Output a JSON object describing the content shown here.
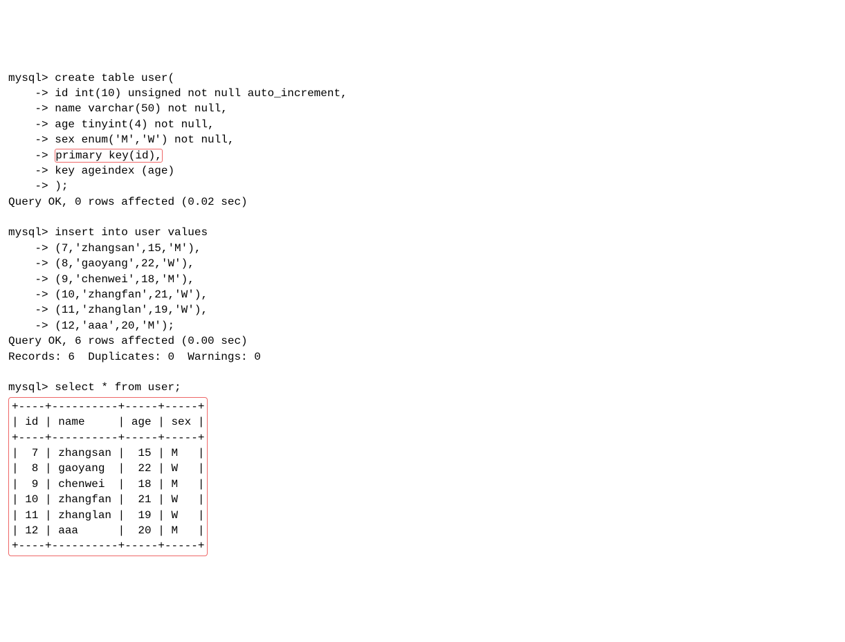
{
  "terminal": {
    "prompt": "mysql> ",
    "cont": "    -> ",
    "create_table": {
      "l0": "create table user(",
      "l1": "id int(10) unsigned not null auto_increment,",
      "l2": "name varchar(50) not null,",
      "l3": "age tinyint(4) not null,",
      "l4": "sex enum('M','W') not null,",
      "l5": "primary key(id),",
      "l6": "key ageindex (age)",
      "l7": ");"
    },
    "create_result": "Query OK, 0 rows affected (0.02 sec)",
    "insert": {
      "l0": "insert into user values",
      "l1": "(7,'zhangsan',15,'M'),",
      "l2": "(8,'gaoyang',22,'W'),",
      "l3": "(9,'chenwei',18,'M'),",
      "l4": "(10,'zhangfan',21,'W'),",
      "l5": "(11,'zhanglan',19,'W'),",
      "l6": "(12,'aaa',20,'M');"
    },
    "insert_result_l1": "Query OK, 6 rows affected (0.00 sec)",
    "insert_result_l2": "Records: 6  Duplicates: 0  Warnings: 0",
    "select_cmd": "select * from user;",
    "table": {
      "border": "+----+----------+-----+-----+",
      "header": "| id | name     | age | sex |",
      "rows": [
        "|  7 | zhangsan |  15 | M   |",
        "|  8 | gaoyang  |  22 | W   |",
        "|  9 | chenwei  |  18 | M   |",
        "| 10 | zhangfan |  21 | W   |",
        "| 11 | zhanglan |  19 | W   |",
        "| 12 | aaa      |  20 | M   |"
      ]
    }
  },
  "chart_data": {
    "type": "table",
    "title": "select * from user",
    "columns": [
      "id",
      "name",
      "age",
      "sex"
    ],
    "rows": [
      {
        "id": 7,
        "name": "zhangsan",
        "age": 15,
        "sex": "M"
      },
      {
        "id": 8,
        "name": "gaoyang",
        "age": 22,
        "sex": "W"
      },
      {
        "id": 9,
        "name": "chenwei",
        "age": 18,
        "sex": "M"
      },
      {
        "id": 10,
        "name": "zhangfan",
        "age": 21,
        "sex": "W"
      },
      {
        "id": 11,
        "name": "zhanglan",
        "age": 19,
        "sex": "W"
      },
      {
        "id": 12,
        "name": "aaa",
        "age": 20,
        "sex": "M"
      }
    ]
  }
}
